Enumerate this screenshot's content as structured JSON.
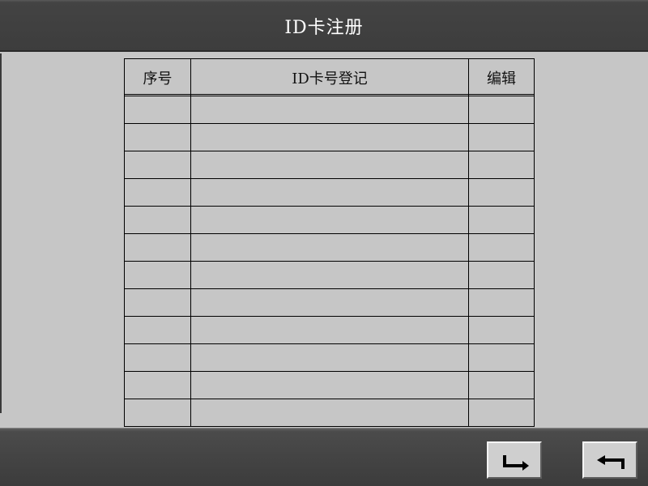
{
  "header": {
    "title": "ID卡注册"
  },
  "table": {
    "columns": [
      "序号",
      "ID卡号登记",
      "编辑"
    ],
    "rows": [
      [
        "",
        "",
        ""
      ],
      [
        "",
        "",
        ""
      ],
      [
        "",
        "",
        ""
      ],
      [
        "",
        "",
        ""
      ],
      [
        "",
        "",
        ""
      ],
      [
        "",
        "",
        ""
      ],
      [
        "",
        "",
        ""
      ],
      [
        "",
        "",
        ""
      ],
      [
        "",
        "",
        ""
      ],
      [
        "",
        "",
        ""
      ],
      [
        "",
        "",
        ""
      ],
      [
        "",
        "",
        ""
      ]
    ]
  },
  "footer": {
    "buttons": [
      {
        "icon": "enter-arrow-icon"
      },
      {
        "icon": "return-arrow-icon"
      }
    ]
  }
}
